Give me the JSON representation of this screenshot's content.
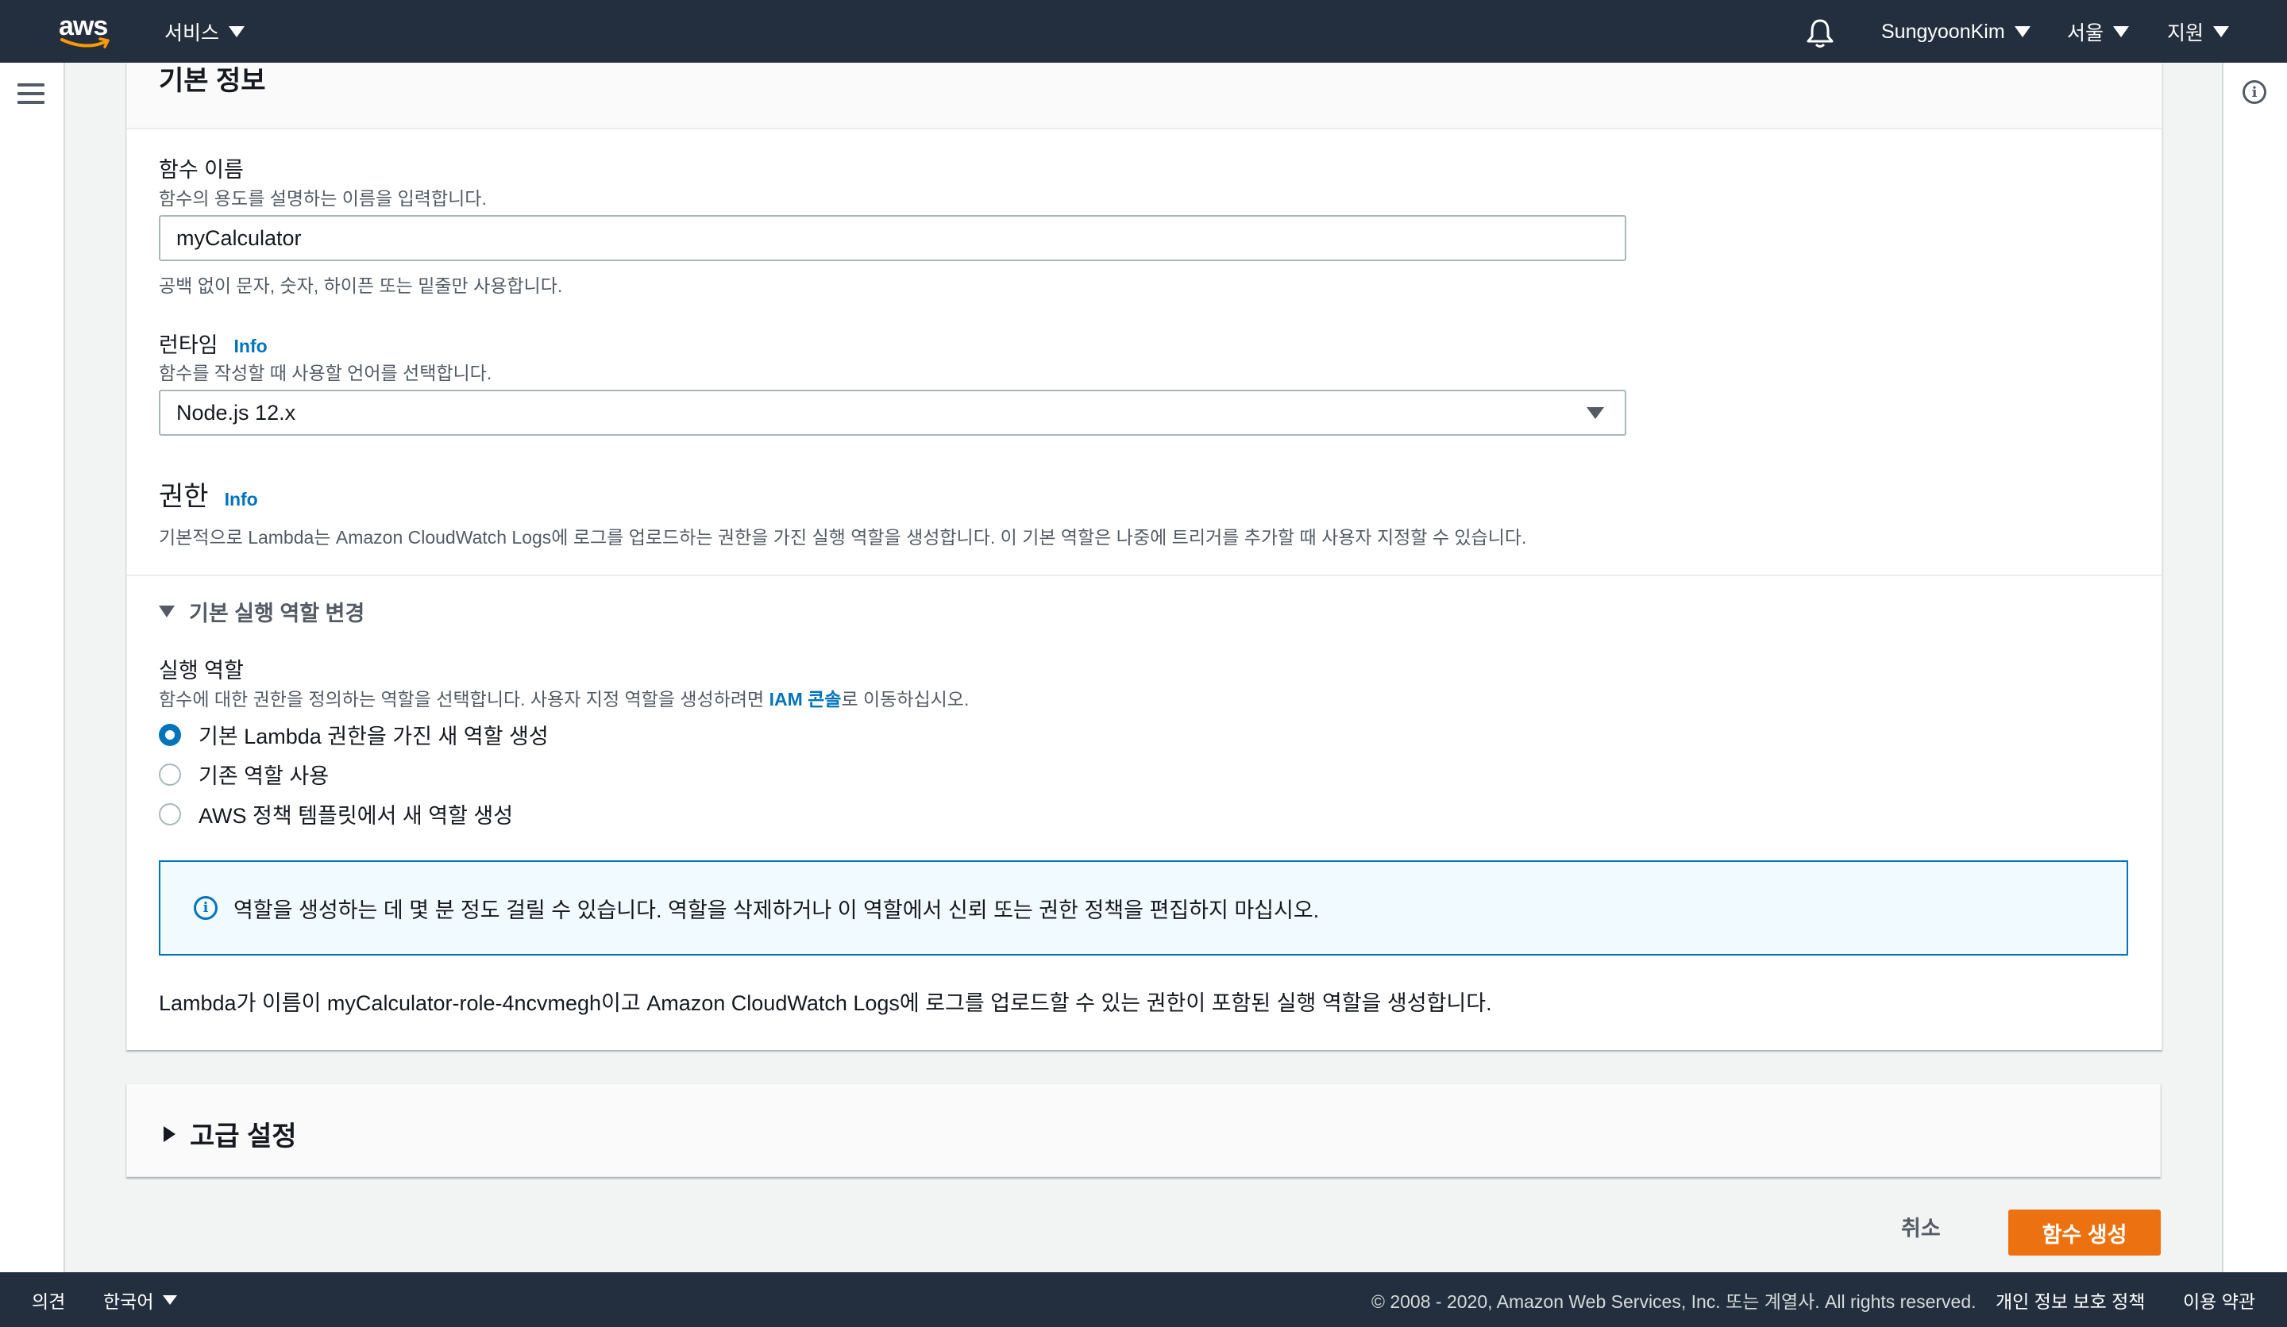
{
  "topnav": {
    "logo_text": "aws",
    "services_label": "서비스",
    "user_label": "SungyoonKim",
    "region_label": "서울",
    "support_label": "지원"
  },
  "basic_info": {
    "heading": "기본 정보",
    "function_name": {
      "label": "함수 이름",
      "description": "함수의 용도를 설명하는 이름을 입력합니다.",
      "value": "myCalculator",
      "constraint": "공백 없이 문자, 숫자, 하이픈 또는 밑줄만 사용합니다."
    },
    "runtime": {
      "label": "런타임",
      "info_link": "Info",
      "description": "함수를 작성할 때 사용할 언어를 선택합니다.",
      "selected": "Node.js 12.x"
    }
  },
  "permissions": {
    "heading": "권한",
    "info_link": "Info",
    "description": "기본적으로 Lambda는 Amazon CloudWatch Logs에 로그를 업로드하는 권한을 가진 실행 역할을 생성합니다. 이 기본 역할은 나중에 트리거를 추가할 때 사용자 지정할 수 있습니다.",
    "expander_label": "기본 실행 역할 변경",
    "execution_role": {
      "label": "실행 역할",
      "description_prefix": "함수에 대한 권한을 정의하는 역할을 선택합니다. 사용자 지정 역할을 생성하려면 ",
      "iam_link": "IAM 콘솔",
      "description_suffix": "로 이동하십시오.",
      "options": [
        {
          "label": "기본 Lambda 권한을 가진 새 역할 생성",
          "checked": true
        },
        {
          "label": "기존 역할 사용",
          "checked": false
        },
        {
          "label": "AWS 정책 템플릿에서 새 역할 생성",
          "checked": false
        }
      ]
    },
    "alert_text": "역할을 생성하는 데 몇 분 정도 걸릴 수 있습니다. 역할을 삭제하거나 이 역할에서 신뢰 또는 권한 정책을 편집하지 마십시오.",
    "summary_text": "Lambda가 이름이 myCalculator-role-4ncvmegh이고 Amazon CloudWatch Logs에 로그를 업로드할 수 있는 권한이 포함된 실행 역할을 생성합니다."
  },
  "advanced": {
    "heading": "고급 설정"
  },
  "actions": {
    "cancel_label": "취소",
    "create_label": "함수 생성"
  },
  "footer": {
    "feedback_label": "의견",
    "language_label": "한국어",
    "copyright": "© 2008 - 2020, Amazon Web Services, Inc. 또는 계열사. All rights reserved.",
    "privacy_label": "개인 정보 보호 정책",
    "terms_label": "이용 약관"
  },
  "colors": {
    "nav_bg": "#232f3e",
    "link": "#0073bb",
    "primary_button": "#ec7211",
    "alert_bg": "#f1faff"
  },
  "icons": [
    "aws-logo-icon",
    "caret-down-icon",
    "bell-icon",
    "menu-icon",
    "info-icon",
    "triangle-down-icon",
    "triangle-right-icon"
  ]
}
